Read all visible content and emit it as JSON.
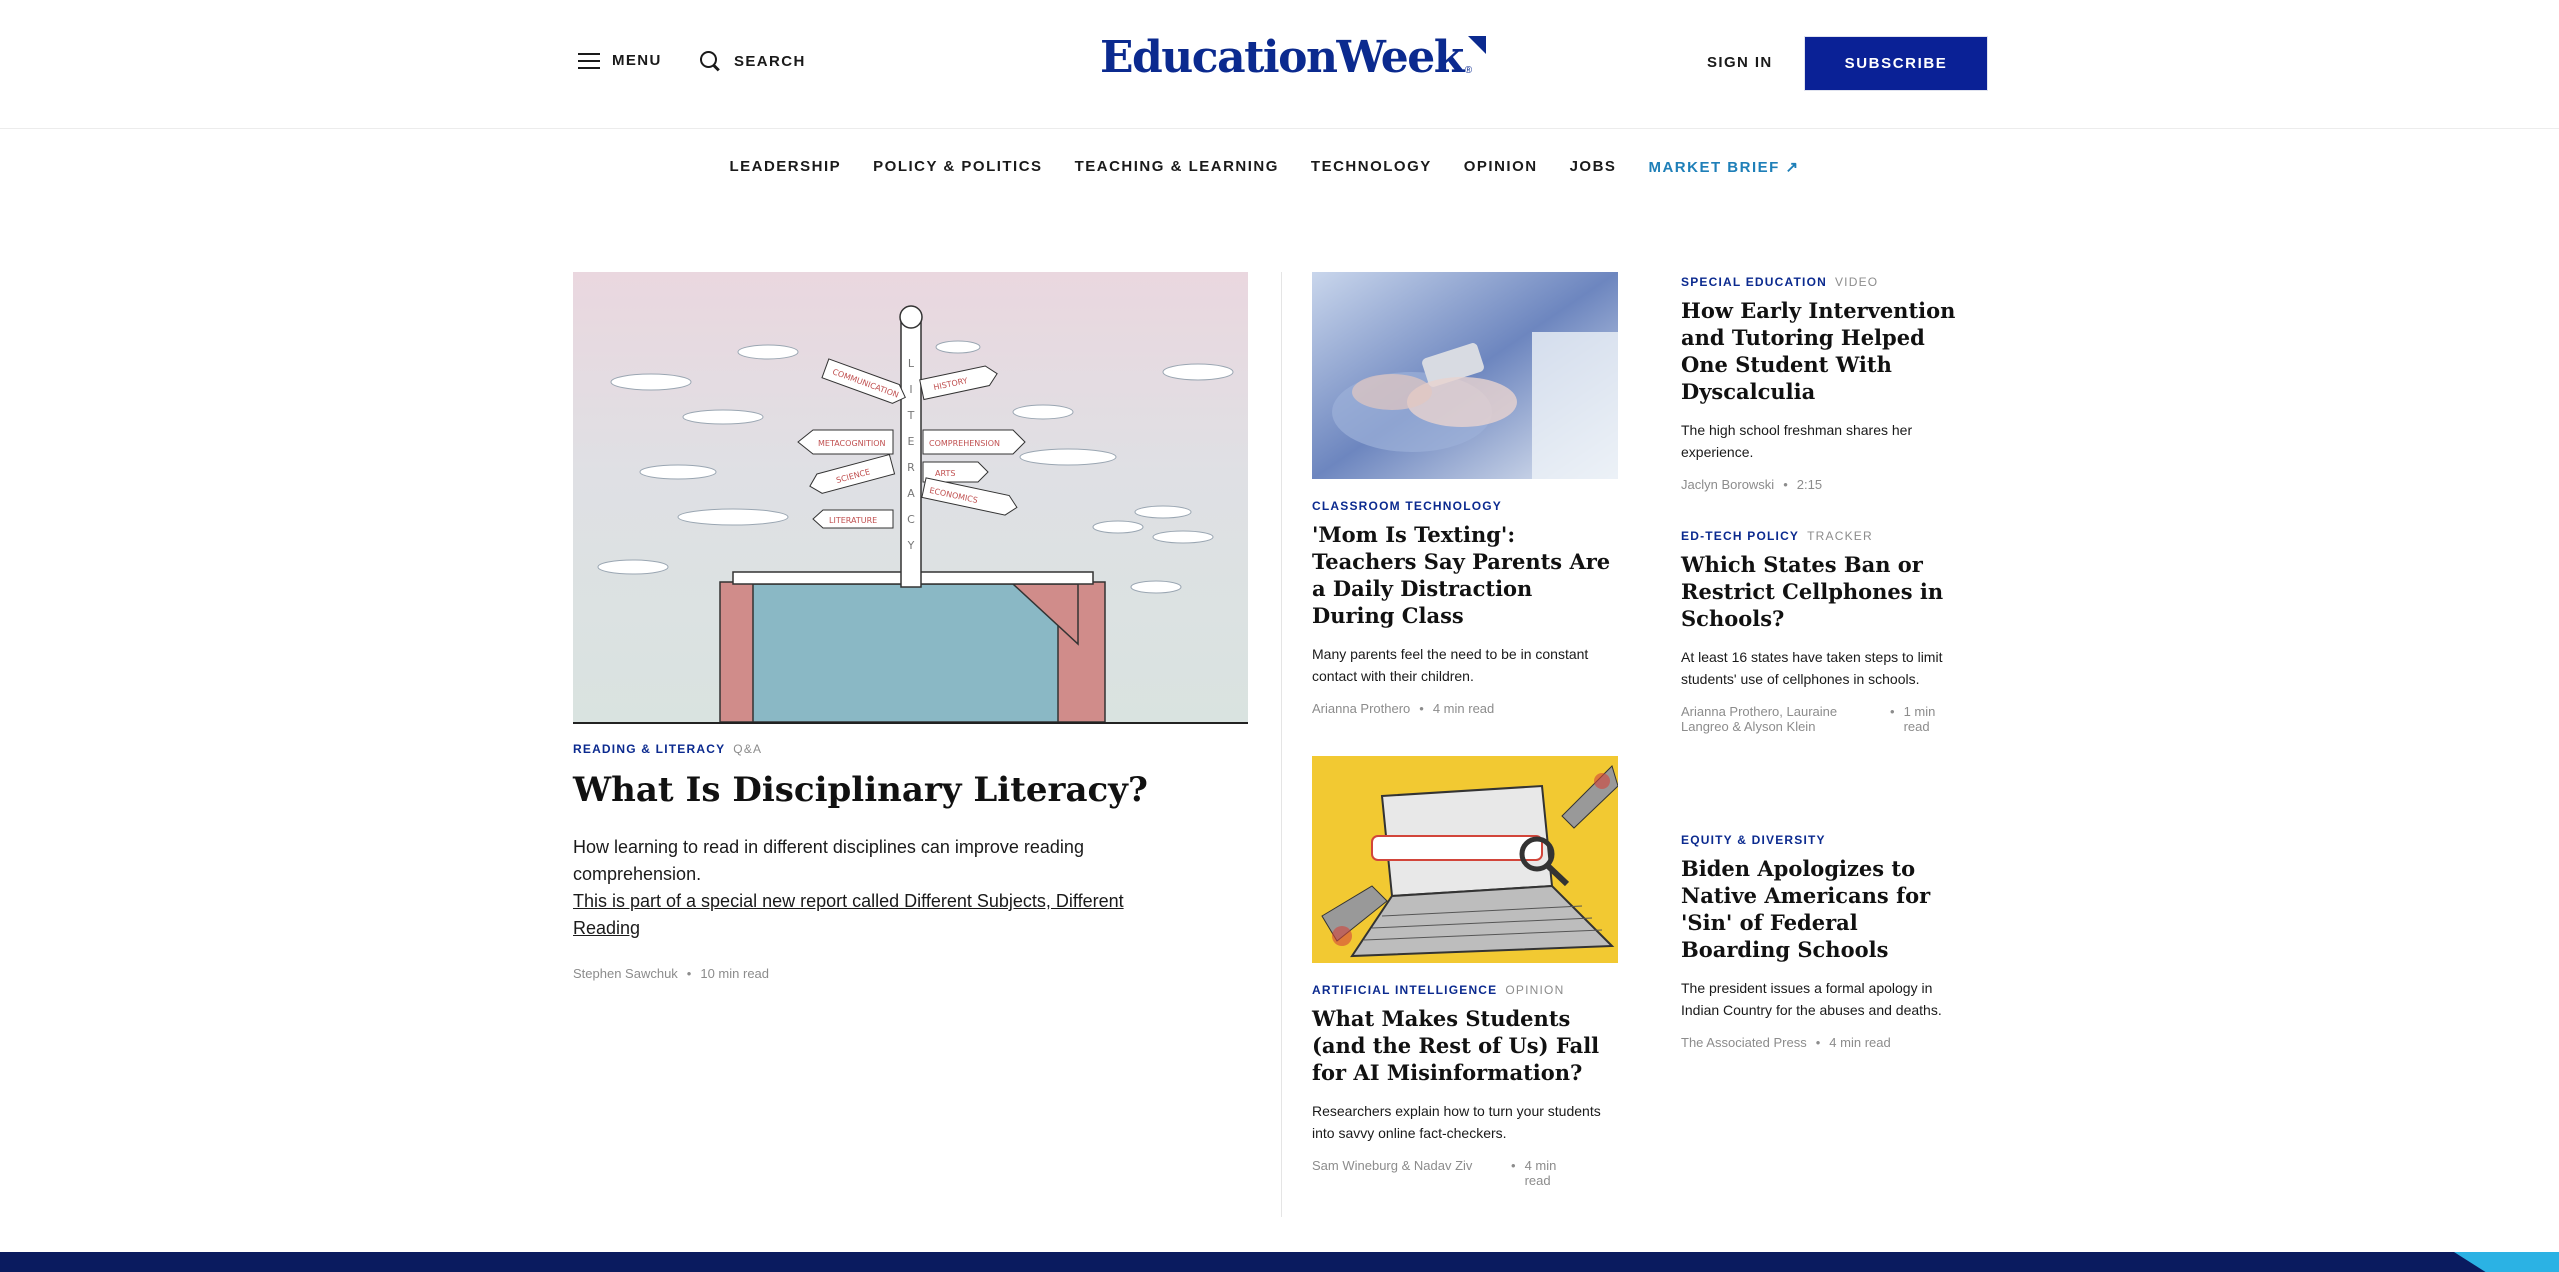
{
  "header": {
    "menu_label": "MENU",
    "search_label": "SEARCH",
    "logo_text": "EducationWeek",
    "logo_reg": "®",
    "signin_label": "SIGN IN",
    "subscribe_label": "SUBSCRIBE"
  },
  "nav": {
    "items": [
      "LEADERSHIP",
      "POLICY & POLITICS",
      "TEACHING & LEARNING",
      "TECHNOLOGY",
      "OPINION",
      "JOBS"
    ],
    "market_brief": "MARKET BRIEF ↗"
  },
  "lead": {
    "kicker": "READING & LITERACY",
    "type": "Q&A",
    "title": "What Is Disciplinary Literacy?",
    "dek": "How learning to read in different disciplines can improve reading comprehension.",
    "link": "This is part of a special new report called Different Subjects, Different Reading",
    "author": "Stephen Sawchuk",
    "read_time": "10 min read",
    "image_signs": [
      "COMMUNICATION",
      "HISTORY",
      "METACOGNITION",
      "COMPREHENSION",
      "SCIENCE",
      "ARTS",
      "ECONOMICS",
      "LITERATURE"
    ],
    "image_post_letters": "LITERACY"
  },
  "middle": [
    {
      "kicker": "CLASSROOM TECHNOLOGY",
      "type": "",
      "title": "'Mom Is Texting': Teachers Say Parents Are a Daily Distraction During Class",
      "dek": "Many parents feel the need to be in constant contact with their children.",
      "author": "Arianna Prothero",
      "read_time": "4 min read"
    },
    {
      "kicker": "ARTIFICIAL INTELLIGENCE",
      "type": "OPINION",
      "title": "What Makes Students (and the Rest of Us) Fall for AI Misinformation?",
      "dek": "Researchers explain how to turn your students into savvy online fact-checkers.",
      "author": "Sam Wineburg & Nadav Ziv",
      "read_time": "4 min read"
    }
  ],
  "right": [
    {
      "kicker": "SPECIAL EDUCATION",
      "type": "VIDEO",
      "title": "How Early Intervention and Tutoring Helped One Student With Dyscalculia",
      "dek": "The high school freshman shares her experience.",
      "author": "Jaclyn Borowski",
      "read_time": "2:15"
    },
    {
      "kicker": "ED-TECH POLICY",
      "type": "TRACKER",
      "title": "Which States Ban or Restrict Cellphones in Schools?",
      "dek": "At least 16 states have taken steps to limit students' use of cellphones in schools.",
      "author": "Arianna Prothero, Lauraine Langreo & Alyson Klein",
      "read_time": "1 min read"
    },
    {
      "kicker": "EQUITY & DIVERSITY",
      "type": "",
      "title": "Biden Apologizes to Native Americans for 'Sin' of Federal Boarding Schools",
      "dek": "The president issues a formal apology in Indian Country for the abuses and deaths.",
      "author": "The Associated Press",
      "read_time": "4 min read"
    }
  ],
  "dot": "•"
}
